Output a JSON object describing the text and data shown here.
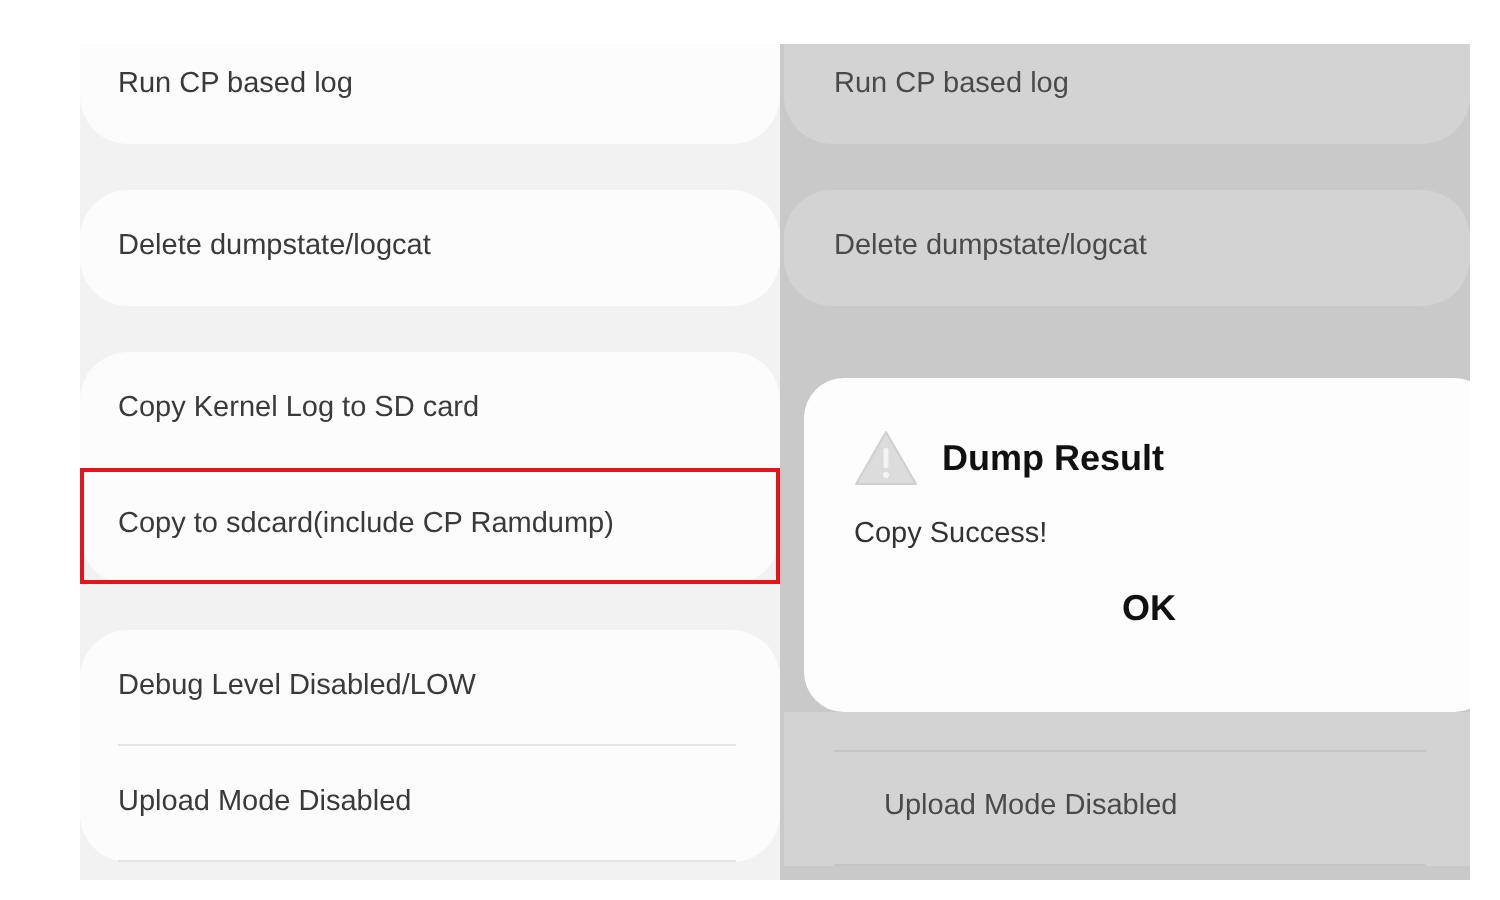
{
  "screens": [
    {
      "dimmed": false,
      "groups": [
        {
          "dividers": false,
          "items": [
            {
              "label": "Run CP based log",
              "highlighted": false
            }
          ]
        },
        {
          "dividers": false,
          "items": [
            {
              "label": "Delete dumpstate/logcat",
              "highlighted": false
            }
          ]
        },
        {
          "dividers": false,
          "items": [
            {
              "label": "Copy Kernel Log to SD card",
              "highlighted": false
            },
            {
              "label": "Copy to sdcard(include CP Ramdump)",
              "highlighted": true
            }
          ]
        },
        {
          "dividers": true,
          "items": [
            {
              "label": "Debug Level Disabled/LOW",
              "highlighted": false
            },
            {
              "label": "Upload Mode Disabled",
              "highlighted": false
            }
          ]
        }
      ]
    },
    {
      "dimmed": true,
      "groups": [
        {
          "dividers": false,
          "items": [
            {
              "label": "Run CP based log",
              "highlighted": false
            }
          ]
        },
        {
          "dividers": false,
          "items": [
            {
              "label": "Delete dumpstate/logcat",
              "highlighted": false
            }
          ]
        },
        {
          "dividers": true,
          "items": [
            {
              "label": "Upload Mode Disabled",
              "highlighted": false
            }
          ]
        }
      ],
      "dialog": {
        "title": "Dump Result",
        "message": "Copy Success!",
        "button": "OK"
      }
    }
  ]
}
